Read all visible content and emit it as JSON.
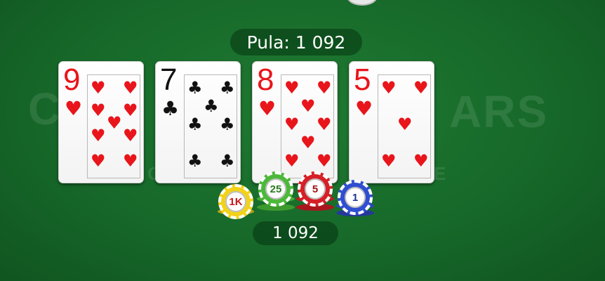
{
  "table": {
    "watermark_left": "CO",
    "watermark_right": "ARS",
    "watermark_sub_left": "O",
    "watermark_sub_right": "ZE"
  },
  "pot": {
    "label": "Pula: 1 092"
  },
  "board": {
    "cards": [
      {
        "rank": "9",
        "suit": "♥",
        "color": "red"
      },
      {
        "rank": "7",
        "suit": "♣",
        "color": "black"
      },
      {
        "rank": "8",
        "suit": "♥",
        "color": "red"
      },
      {
        "rank": "5",
        "suit": "♥",
        "color": "red"
      }
    ]
  },
  "chips": [
    {
      "label": "1K",
      "color": "#f2d21a"
    },
    {
      "label": "25",
      "color": "#4cb83a"
    },
    {
      "label": "5",
      "color": "#d61f26"
    },
    {
      "label": "1",
      "color": "#2f4fd0"
    }
  ],
  "bet": {
    "amount": "1 092"
  }
}
